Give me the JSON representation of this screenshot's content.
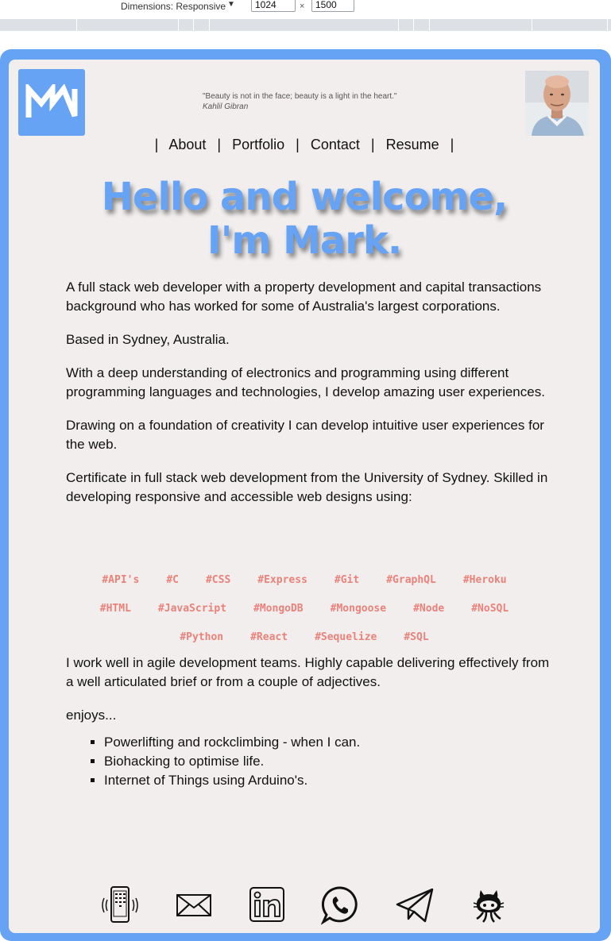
{
  "devtools": {
    "dimensions_label": "Dimensions: Responsive",
    "width_value": "1024",
    "times": "×",
    "height_value": "1500"
  },
  "header": {
    "quote_text": "\"Beauty is not in the face; beauty is a light in the heart.\"",
    "quote_author": "Kahlil Gibran"
  },
  "nav": {
    "sep": "|",
    "items": [
      "About",
      "Portfolio",
      "Contact",
      "Resume"
    ]
  },
  "hero": {
    "line1": "Hello and welcome,",
    "line2": "I'm Mark."
  },
  "about": {
    "p1": "A full stack web developer with a property development and capital transactions background who has worked for some of Australia's largest corporations.",
    "p2": "Based in Sydney, Australia.",
    "p3": "With a deep understanding of electronics and programming using different programming languages and technologies, I develop amazing user experiences.",
    "p4": "Drawing on a foundation of creativity I can develop intuitive user experiences for the web.",
    "p5": "Certificate in full stack web development from the University of Sydney. Skilled in developing responsive and accessible web designs using:"
  },
  "tags": {
    "row1": [
      "#API's",
      "#C",
      "#CSS",
      "#Express",
      "#Git",
      "#GraphQL",
      "#Heroku"
    ],
    "row2": [
      "#HTML",
      "#JavaScript",
      "#MongoDB",
      "#Mongoose",
      "#Node",
      "#NoSQL"
    ],
    "row3": [
      "#Python",
      "#React",
      "#Sequelize",
      "#SQL"
    ]
  },
  "more": {
    "p6": "I work well in agile development teams. Highly capable delivering effectively from a well articulated brief or from a couple of adjectives.",
    "p7": "enjoys...",
    "enjoys": [
      "Powerlifting and rockclimbing - when I can.",
      "Biohacking to optimise life.",
      "Internet of Things using Arduino's."
    ]
  },
  "social": {
    "icons": [
      "phone-icon",
      "email-icon",
      "linkedin-icon",
      "whatsapp-icon",
      "telegram-icon",
      "github-icon"
    ]
  },
  "colors": {
    "accent": "#66a3f5",
    "page_bg": "#f2eeee",
    "tag": "#e9827a"
  }
}
